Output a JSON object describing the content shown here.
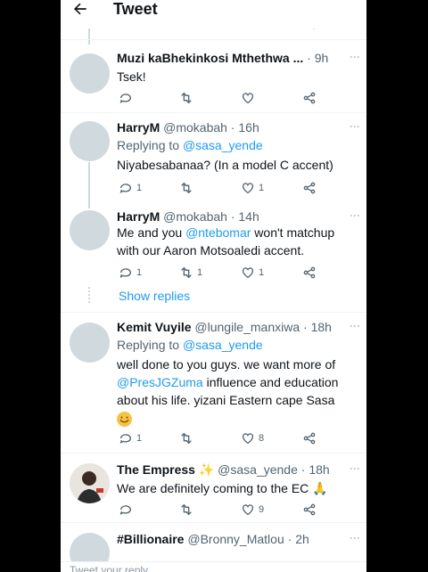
{
  "header": {
    "title": "Tweet",
    "back_icon": "arrow-left-icon"
  },
  "colors": {
    "accent": "#1d9bf0",
    "text": "#0f1419",
    "muted": "#536471",
    "divider": "#eff3f4"
  },
  "tweets": [
    {
      "name": "Muzi kaBhekinkosi Mthethwa ...",
      "handle": "",
      "time": "· 9h",
      "replying_label": "",
      "replying_to": "",
      "text": "Tsek!",
      "counts": {
        "reply": "",
        "retweet": "",
        "like": ""
      }
    },
    {
      "name": "HarryM",
      "handle": "@mokabah",
      "time": "· 16h",
      "replying_label": "Replying to",
      "replying_to": "@sasa_yende",
      "text": "Niyabesabanaa? (In a model C accent)",
      "counts": {
        "reply": "1",
        "retweet": "",
        "like": "1"
      }
    },
    {
      "name": "HarryM",
      "handle": "@mokabah",
      "time": "· 14h",
      "text_prefix": "Me and you ",
      "mention": "@ntebomar",
      "text_suffix": " won't matchup with our Aaron Motsoaledi accent.",
      "counts": {
        "reply": "1",
        "retweet": "1",
        "like": "1"
      }
    },
    {
      "name": "Kemit Vuyile",
      "handle": "@lungile_manxiwa",
      "time": "· 18h",
      "replying_label": "Replying to",
      "replying_to": "@sasa_yende",
      "text_prefix": "well done to you guys. we want more of ",
      "mention": "@PresJGZuma",
      "text_suffix": " influence and education about his life. yizani Eastern cape Sasa",
      "counts": {
        "reply": "1",
        "retweet": "",
        "like": "8"
      }
    },
    {
      "name": "The Empress",
      "handle": "@sasa_yende",
      "time": "· 18h",
      "text": "We are definitely coming to the EC",
      "counts": {
        "reply": "",
        "retweet": "",
        "like": "9"
      }
    },
    {
      "name": "#Billionaire",
      "handle": "@Bronny_Matlou",
      "time": "· 2h",
      "text": ""
    }
  ],
  "show_replies": "Show replies",
  "reply_placeholder": "Tweet your reply"
}
